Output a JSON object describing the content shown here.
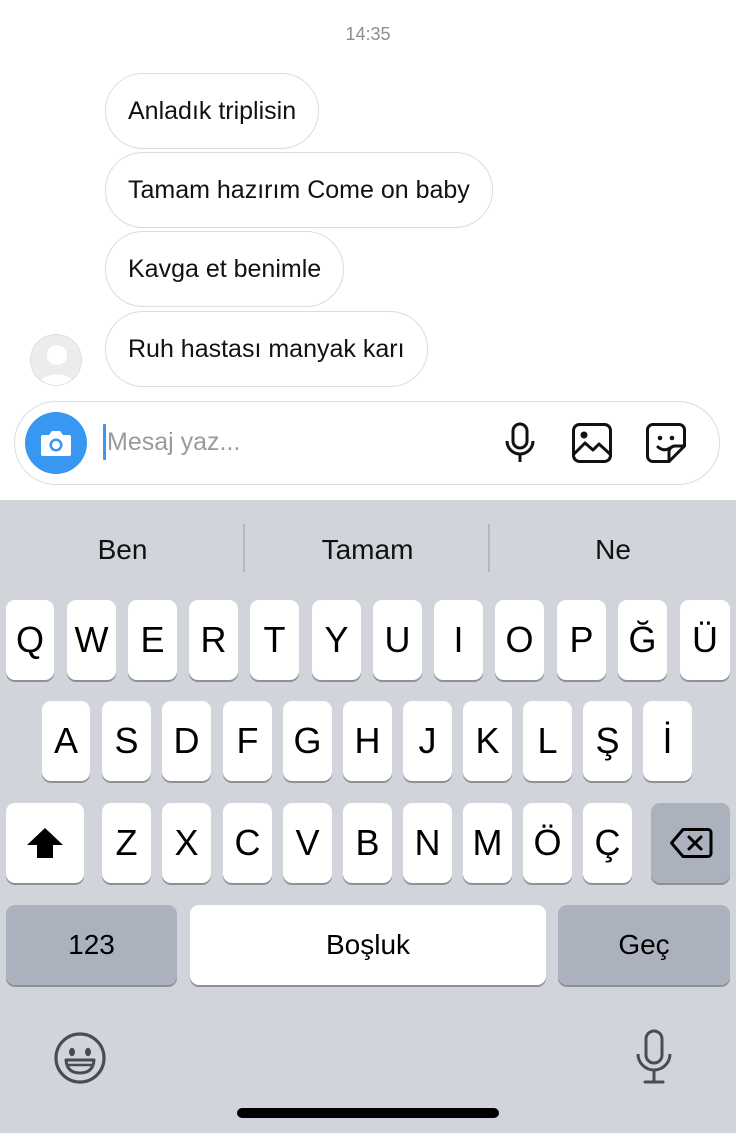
{
  "conversation": {
    "timestamp": "14:35",
    "messages": [
      "Anladık triplisin",
      "Tamam hazırım Come on baby",
      "Kavga et benimle",
      "Ruh hastası manyak karı"
    ]
  },
  "composer": {
    "placeholder": "Mesaj yaz...",
    "icons": [
      "camera-icon",
      "microphone-icon",
      "gallery-icon",
      "sticker-icon"
    ],
    "accent_color": "#3897f0"
  },
  "keyboard": {
    "suggestions": [
      "Ben",
      "Tamam",
      "Ne"
    ],
    "row1": [
      "Q",
      "W",
      "E",
      "R",
      "T",
      "Y",
      "U",
      "I",
      "O",
      "P",
      "Ğ",
      "Ü"
    ],
    "row2": [
      "A",
      "S",
      "D",
      "F",
      "G",
      "H",
      "J",
      "K",
      "L",
      "Ş",
      "İ"
    ],
    "row3": [
      "Z",
      "X",
      "C",
      "V",
      "B",
      "N",
      "M",
      "Ö",
      "Ç"
    ],
    "numbers_label": "123",
    "space_label": "Boşluk",
    "return_label": "Geç",
    "icons": [
      "shift-icon",
      "backspace-icon",
      "emoji-icon",
      "dictation-icon"
    ],
    "background_color": "#d1d4db"
  }
}
